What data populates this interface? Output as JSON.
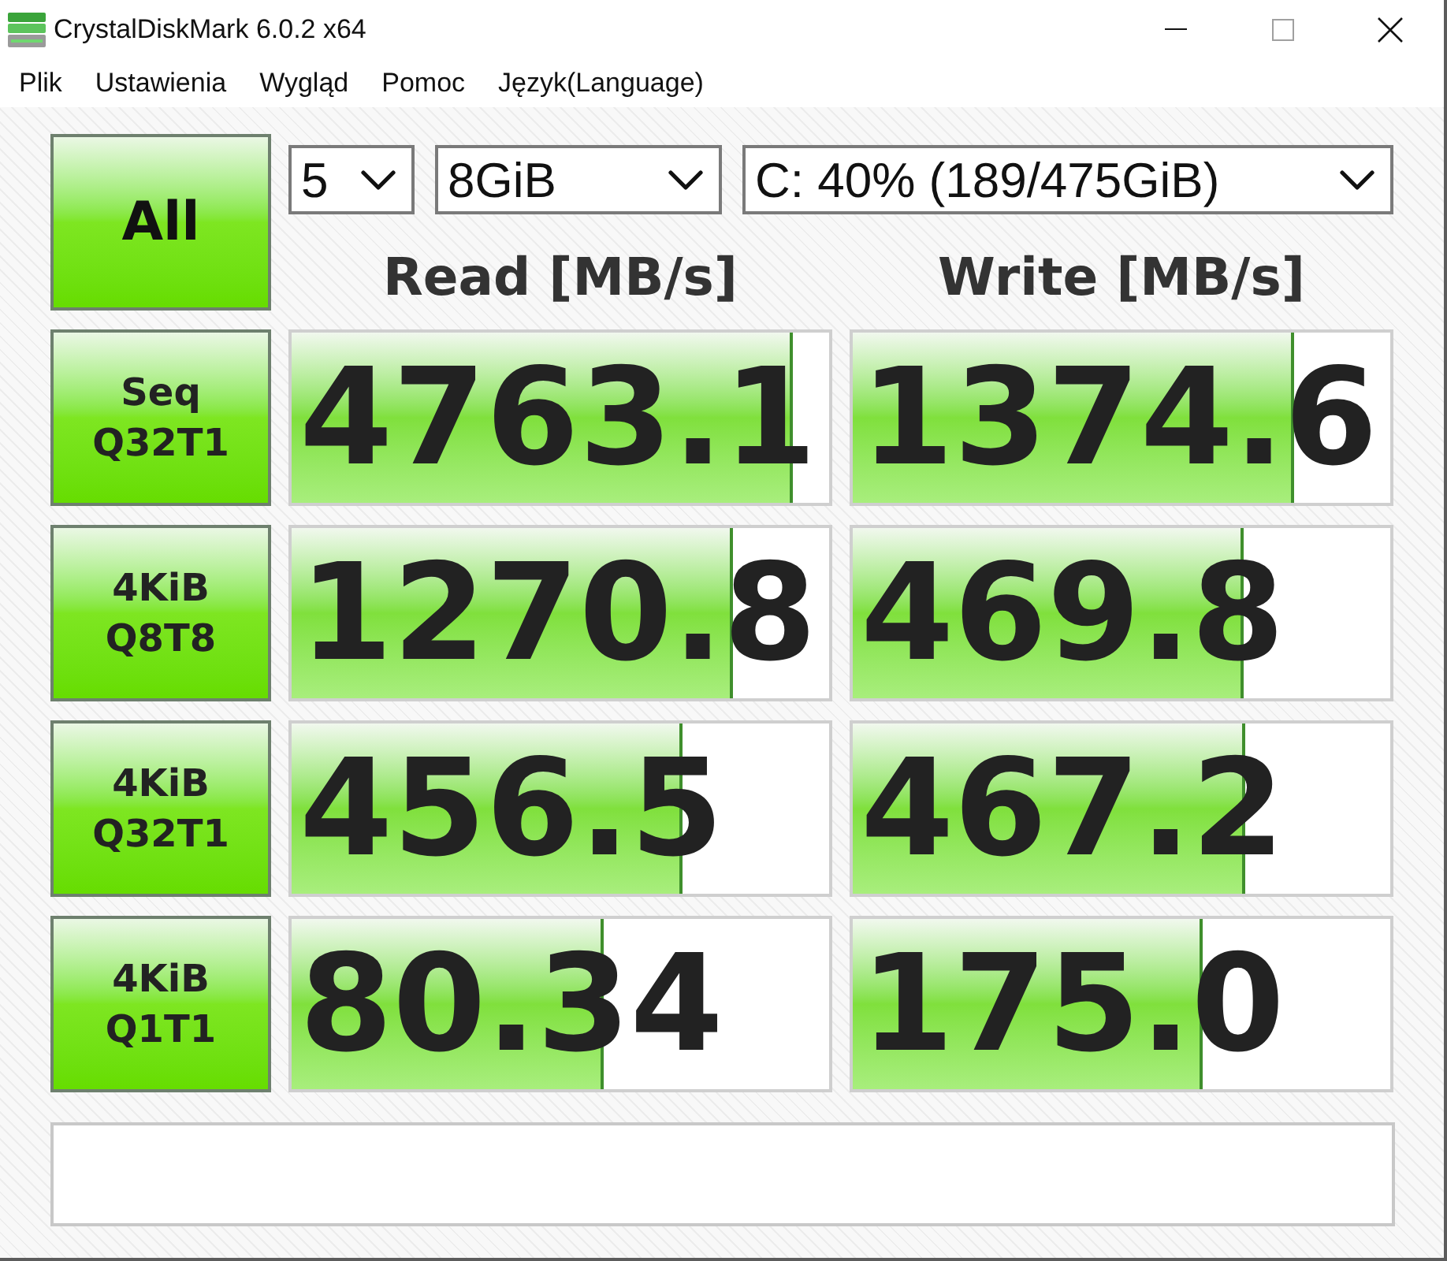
{
  "window": {
    "title": "CrystalDiskMark 6.0.2 x64"
  },
  "menu": [
    "Plik",
    "Ustawienia",
    "Wygląd",
    "Pomoc",
    "Język(Language)"
  ],
  "controls": {
    "all_button": "All",
    "count": "5",
    "size": "8GiB",
    "drive": "C: 40% (189/475GiB)"
  },
  "columns": [
    "Read [MB/s]",
    "Write [MB/s]"
  ],
  "tests": [
    {
      "name": "Seq",
      "params": "Q32T1",
      "read": {
        "value": "4763.1",
        "level": 0.933
      },
      "write": {
        "value": "1374.6",
        "level": 0.82
      }
    },
    {
      "name": "4KiB",
      "params": "Q8T8",
      "read": {
        "value": "1270.8",
        "level": 0.82
      },
      "write": {
        "value": "469.8",
        "level": 0.727
      }
    },
    {
      "name": "4KiB",
      "params": "Q32T1",
      "read": {
        "value": "456.5",
        "level": 0.726
      },
      "write": {
        "value": "467.2",
        "level": 0.73
      }
    },
    {
      "name": "4KiB",
      "params": "Q1T1",
      "read": {
        "value": "80.34",
        "level": 0.58
      },
      "write": {
        "value": "175.0",
        "level": 0.65
      }
    }
  ]
}
